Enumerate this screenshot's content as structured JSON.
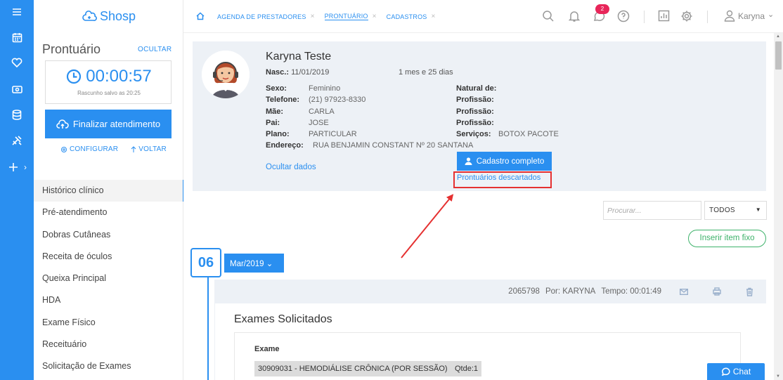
{
  "app": {
    "logo_text": "Shosp"
  },
  "colors": {
    "primary": "#2a8ff0",
    "danger": "#e53030",
    "success": "#3db26a",
    "badge": "#e8265a"
  },
  "rail": {
    "items": [
      {
        "icon": "menu-icon"
      },
      {
        "icon": "calendar-icon"
      },
      {
        "icon": "heart-icon"
      },
      {
        "icon": "money-icon"
      },
      {
        "icon": "database-icon"
      },
      {
        "icon": "tools-icon"
      },
      {
        "icon": "plus-icon"
      }
    ],
    "expand_glyph": "›"
  },
  "sidebar": {
    "title": "Prontuário",
    "hide_label": "OCULTAR",
    "timer": "00:00:57",
    "draft_status": "Rascunho salvo as 20:25",
    "finish_button": "Finalizar atendimento",
    "configure_label": "CONFIGURAR",
    "back_label": "VOLTAR",
    "menu": [
      "Histórico clínico",
      "Pré-atendimento",
      "Dobras Cutâneas",
      "Receita de óculos",
      "Queixa Principal",
      "HDA",
      "Exame Físico",
      "Receituário",
      "Solicitação de Exames"
    ]
  },
  "topbar": {
    "tabs": [
      {
        "label": "AGENDA DE PRESTADORES",
        "close": "×"
      },
      {
        "label": "PRONTUÁRIO",
        "close": "×"
      },
      {
        "label": "CADASTROS",
        "close": "×"
      }
    ],
    "notification_count": "2",
    "user_name": "Karyna",
    "user_caret": "⌄"
  },
  "patient": {
    "name": "Karyna Teste",
    "birth_label": "Nasc.:",
    "birth_date": "11/01/2019",
    "age": "1 mes e 25 dias",
    "fields_left": [
      {
        "label": "Sexo:",
        "value": "Feminino"
      },
      {
        "label": "Telefone:",
        "value": "(21) 97923-8330"
      },
      {
        "label": "Mãe:",
        "value": "CARLA"
      },
      {
        "label": "Pai:",
        "value": "JOSE"
      },
      {
        "label": "Plano:",
        "value": "PARTICULAR"
      },
      {
        "label": "Endereço:",
        "value": "RUA BENJAMIN CONSTANT Nº 20 SANTANA"
      }
    ],
    "fields_right": [
      {
        "label": "Natural de:",
        "value": ""
      },
      {
        "label": "Profissão:",
        "value": ""
      },
      {
        "label": "Profissão:",
        "value": ""
      },
      {
        "label": "Profissão:",
        "value": ""
      },
      {
        "label": "Serviços:",
        "value": "BOTOX PACOTE"
      }
    ],
    "hide_data_label": "Ocultar dados",
    "full_record_button": "Cadastro completo",
    "discarded_link": "Prontuários descartados"
  },
  "filters": {
    "search_placeholder": "Procurar...",
    "select_value": "TODOS",
    "select_caret": "▼",
    "fixed_item_button": "Inserir item fixo"
  },
  "timeline": {
    "day": "06",
    "month_button": "Mar/2019",
    "month_caret": "⌄"
  },
  "entry": {
    "id": "2065798",
    "by": "Por: KARYNA",
    "time": "Tempo: 00:01:49",
    "section_title": "Exames Solicitados",
    "exam_label": "Exame",
    "exam_value": "30909031 - HEMODIÁLISE CRÔNICA (POR SESSÃO)",
    "qty": "Qtde:1"
  },
  "chat": {
    "label": "Chat"
  },
  "scrollbar": {
    "up": "▲",
    "down": "▼"
  }
}
